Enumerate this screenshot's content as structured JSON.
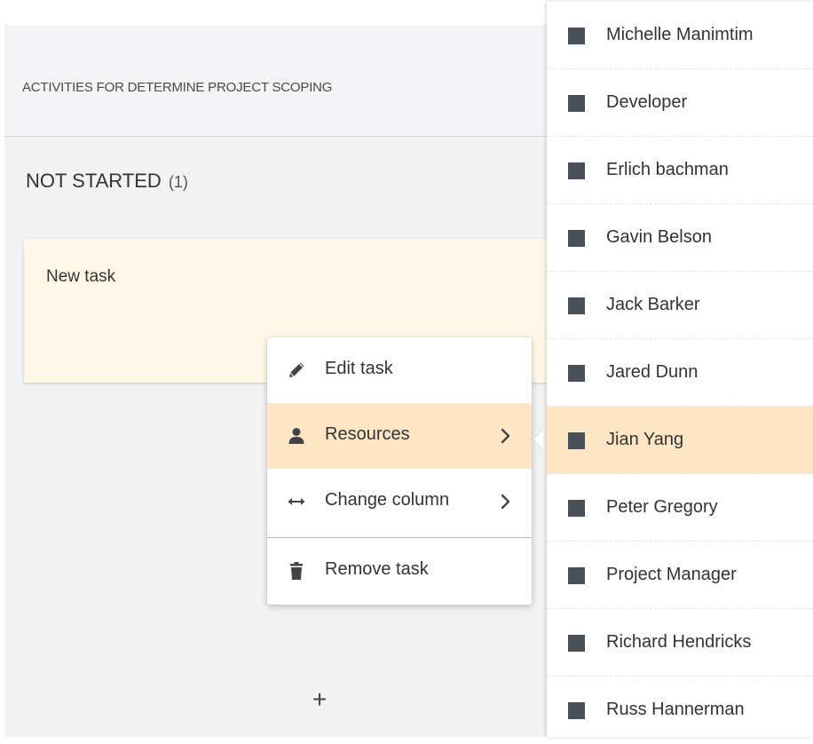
{
  "board": {
    "title": "ACTIVITIES FOR DETERMINE PROJECT SCOPING",
    "column": {
      "name": "NOT STARTED",
      "count": "(1)"
    },
    "task": {
      "title": "New task"
    },
    "add_label": "+"
  },
  "context_menu": {
    "items": [
      {
        "label": "Edit task",
        "icon": "pencil-icon"
      },
      {
        "label": "Resources",
        "icon": "person-icon",
        "has_submenu": true,
        "active": true
      },
      {
        "label": "Change column",
        "icon": "horizontal-arrows-icon",
        "has_submenu": true
      },
      {
        "label": "Remove task",
        "icon": "trash-icon"
      }
    ]
  },
  "resources": {
    "highlighted": "Jian Yang",
    "items": [
      "Michelle Manimtim",
      "Developer",
      "Erlich bachman",
      "Gavin Belson",
      "Jack Barker",
      "Jared Dunn",
      "Jian Yang",
      "Peter Gregory",
      "Project Manager",
      "Richard Hendricks",
      "Russ Hannerman"
    ]
  },
  "colors": {
    "board_background": "#f2f2f3",
    "task_card": "#fff8e7",
    "highlight": "#fde5c6",
    "resource_swatch": "#4a5058"
  }
}
